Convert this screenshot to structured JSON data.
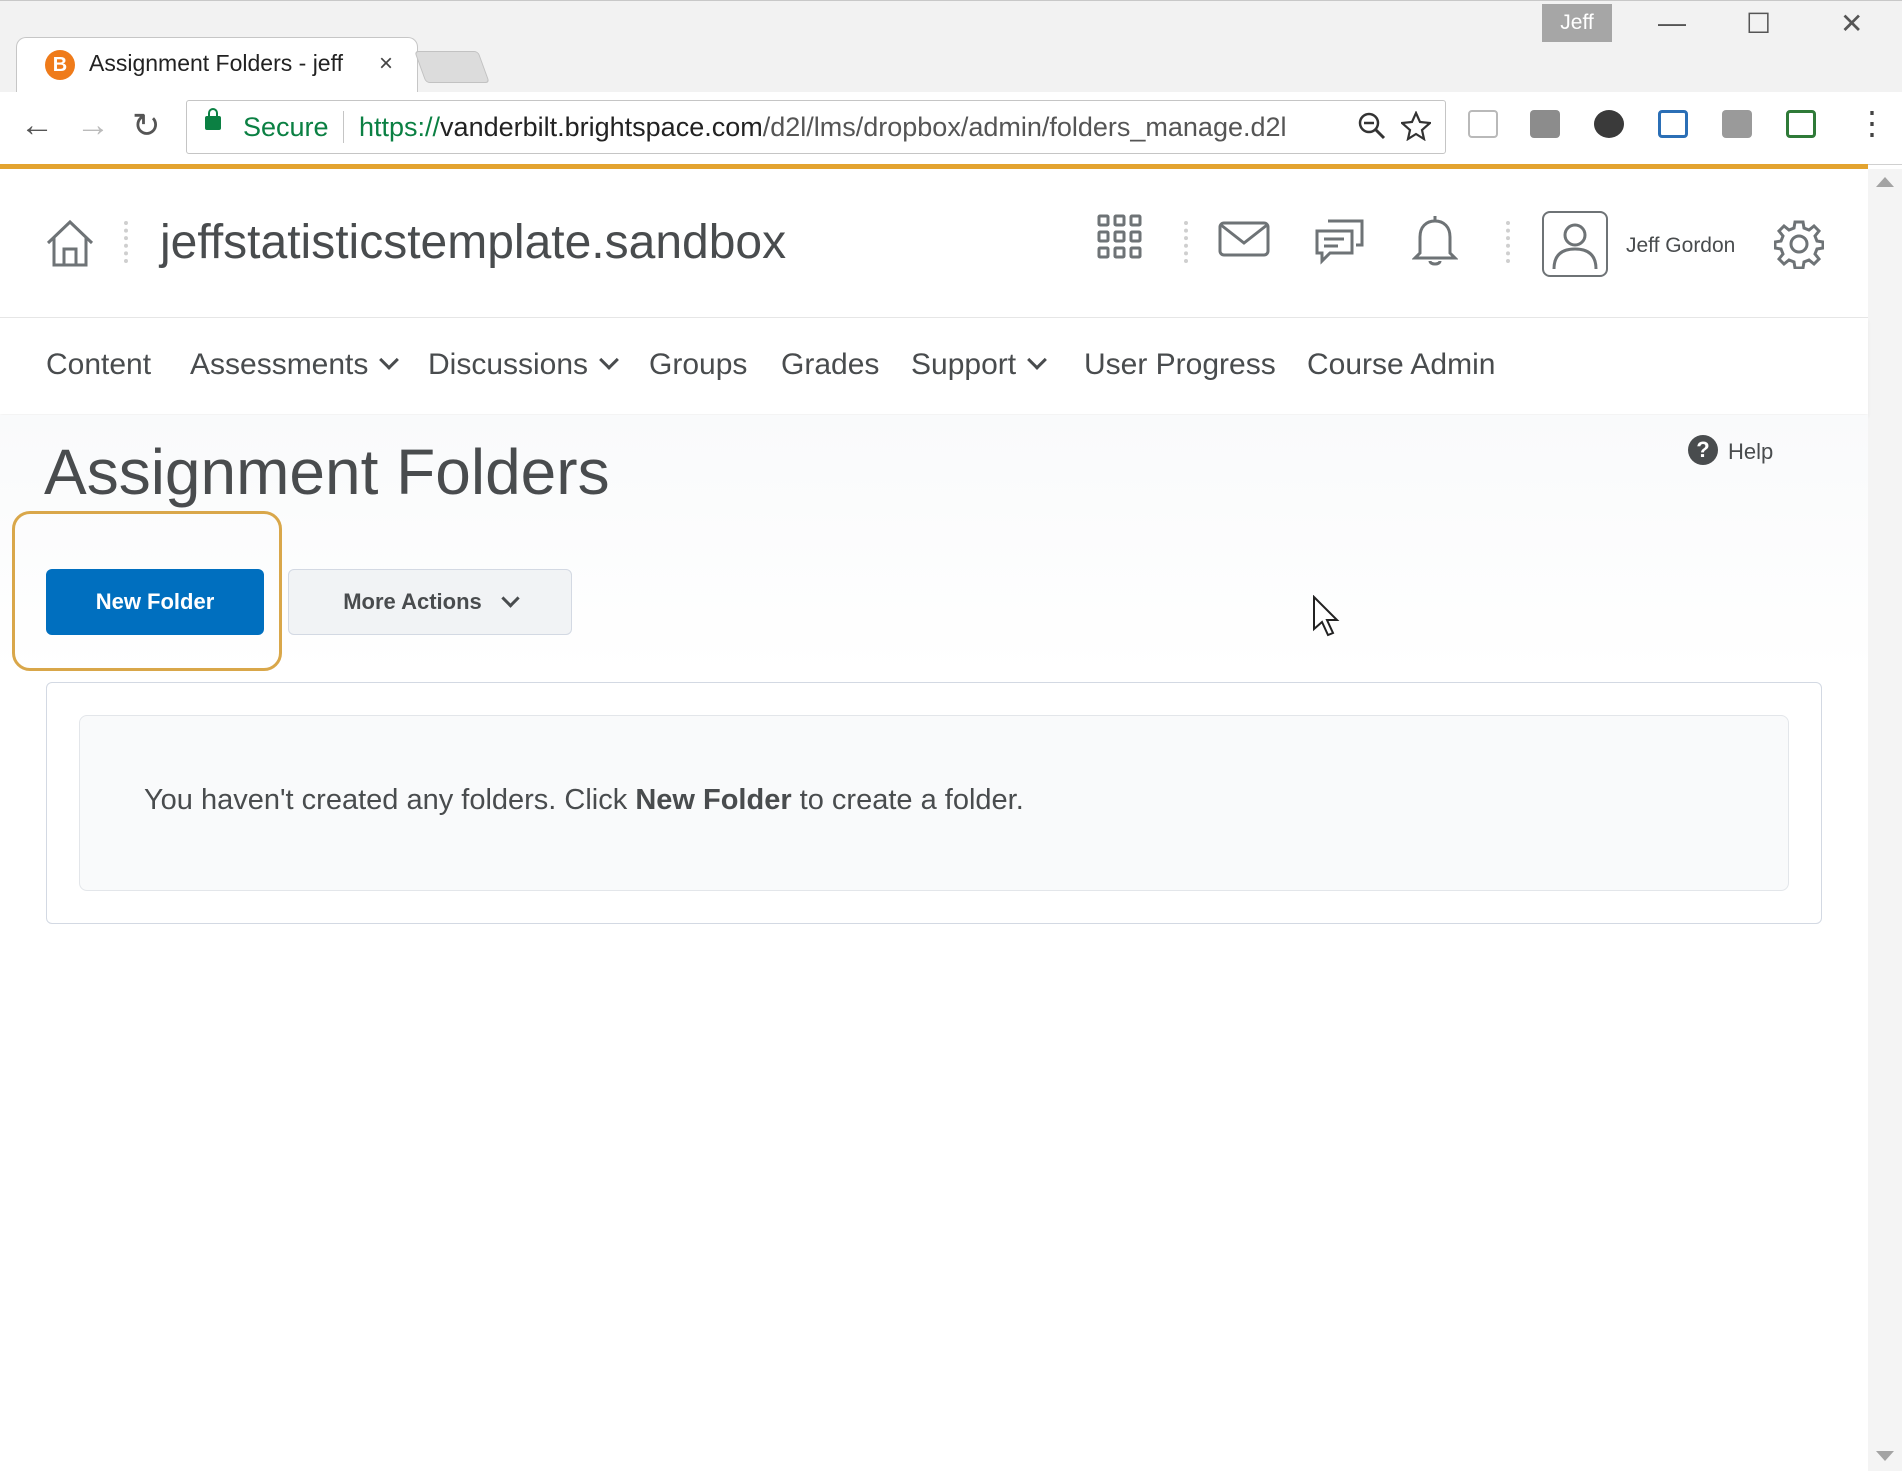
{
  "browser": {
    "tab_title": "Assignment Folders - jeff",
    "tab_close": "×",
    "profile_name": "Jeff",
    "secure_label": "Secure",
    "url_scheme": "https://",
    "url_host": "vanderbilt.brightspace.com",
    "url_path": "/d2l/lms/dropbox/admin/folders_manage.d2l",
    "back": "←",
    "forward": "→",
    "reload": "↻",
    "minimize": "—",
    "maximize": "☐",
    "close": "✕",
    "menu": "⋮"
  },
  "header": {
    "org_title": "jeffstatisticstemplate.sandbox",
    "username": "Jeff Gordon"
  },
  "nav": {
    "items": [
      {
        "label": "Content"
      },
      {
        "label": "Assessments"
      },
      {
        "label": "Discussions"
      },
      {
        "label": "Groups"
      },
      {
        "label": "Grades"
      },
      {
        "label": "Support"
      },
      {
        "label": "User Progress"
      },
      {
        "label": "Course Admin"
      }
    ]
  },
  "main": {
    "title": "Assignment Folders",
    "help_label": "Help",
    "help_icon": "?",
    "new_folder_label": "New Folder",
    "more_actions_label": "More Actions",
    "empty_msg_prefix": "You haven't created any folders. Click ",
    "empty_msg_bold": "New Folder",
    "empty_msg_suffix": " to create a folder."
  },
  "colors": {
    "accent_orange": "#e3a32f",
    "primary_blue": "#006fbf",
    "secure_green": "#0b8043",
    "text": "#494c4e"
  }
}
